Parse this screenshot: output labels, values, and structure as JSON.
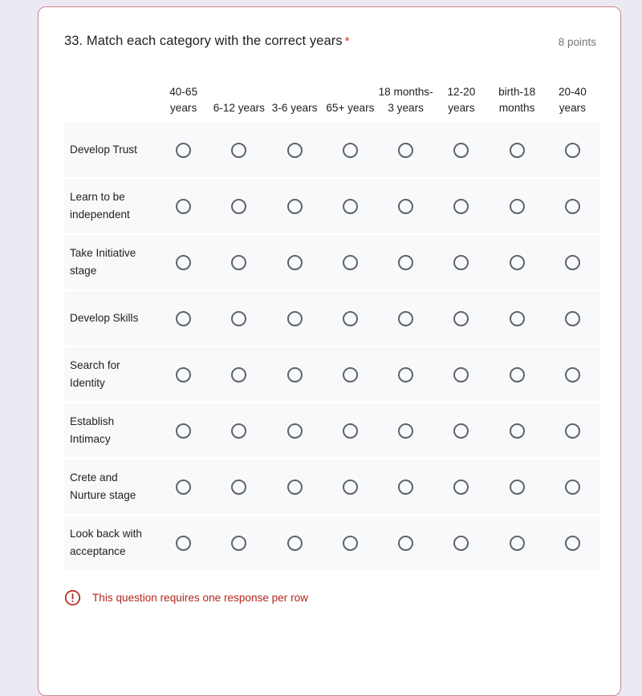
{
  "question": {
    "number_and_text": "33. Match each category with the correct years",
    "required_marker": "*",
    "points": "8 points"
  },
  "grid": {
    "columns": [
      "40-65\nyears",
      "6-12\nyears",
      "3-6\nyears",
      "65+\nyears",
      "18\nmonths-\n3 years",
      "12-20\nyears",
      "birth-18\nmonths",
      "20-40\nyears"
    ],
    "rows": [
      "Develop Trust",
      "Learn to be independent",
      "Take Initiative stage",
      "Develop Skills",
      "Search for Identity",
      "Establish Intimacy",
      "Crete and Nurture stage",
      "Look back with acceptance"
    ],
    "selected": [
      null,
      null,
      null,
      null,
      null,
      null,
      null,
      null
    ]
  },
  "error": {
    "icon": "error-exclamation-icon",
    "message": "This question requires one response per row"
  },
  "colors": {
    "page_background": "#ece9f3",
    "card_background": "#ffffff",
    "card_border": "#c9898e",
    "row_background": "#f8f9fa",
    "error_text": "#b3261e",
    "required_asterisk": "#d93025",
    "radio_border": "#5f6368",
    "points_text": "#70757a"
  }
}
